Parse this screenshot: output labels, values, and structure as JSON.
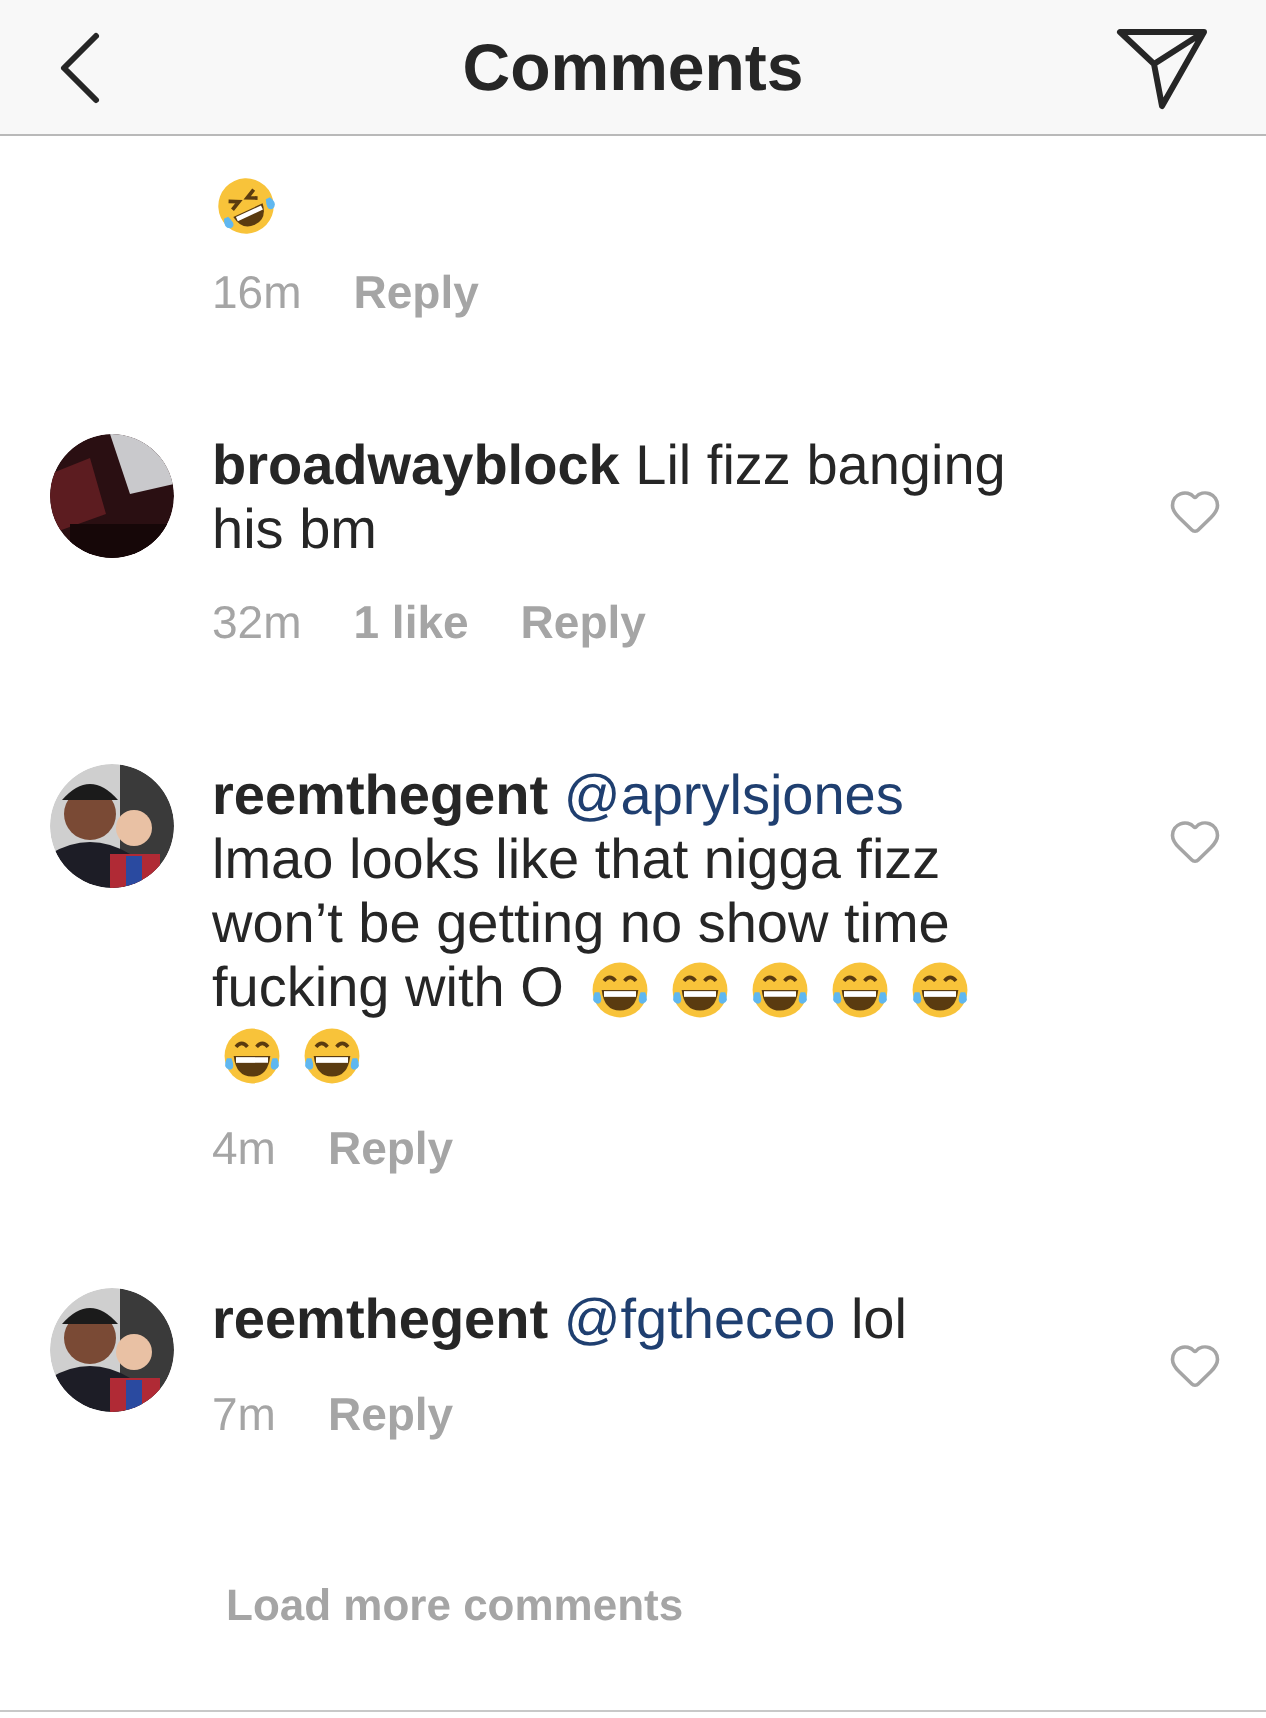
{
  "header": {
    "title": "Comments"
  },
  "comments": [
    {
      "kind": "partial",
      "emojis": [
        {
          "kind": "rofl"
        }
      ],
      "time": "16m",
      "reply": "Reply"
    },
    {
      "kind": "full",
      "username": "broadwayblock",
      "text": "Lil fizz banging his bm",
      "time": "32m",
      "likes": "1 like",
      "reply": "Reply"
    },
    {
      "kind": "full",
      "username": "reemthegent",
      "mention": "@aprylsjones",
      "text": "lmao looks like that nigga fizz won’t be getting no show time fucking with O",
      "emojis": [
        {
          "kind": "joy"
        },
        {
          "kind": "joy"
        },
        {
          "kind": "joy"
        },
        {
          "kind": "joy"
        },
        {
          "kind": "joy"
        },
        {
          "kind": "joy"
        },
        {
          "kind": "joy"
        }
      ],
      "time": "4m",
      "reply": "Reply"
    },
    {
      "kind": "full",
      "username": "reemthegent",
      "mention": "@fgtheceo",
      "text": "lol",
      "time": "7m",
      "reply": "Reply"
    }
  ],
  "load_more": "Load more comments"
}
